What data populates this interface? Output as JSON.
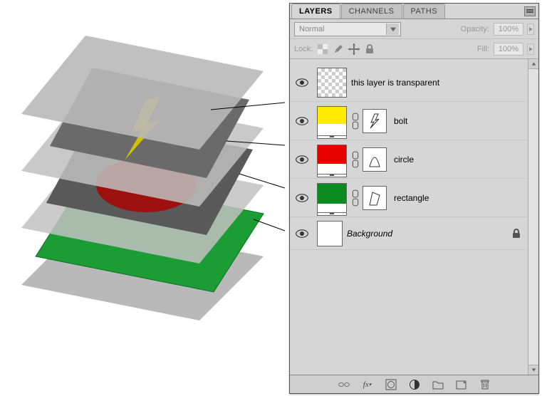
{
  "tabs": {
    "layers": "LAYERS",
    "channels": "CHANNELS",
    "paths": "PATHS"
  },
  "controls": {
    "blend_mode": "Normal",
    "opacity_label": "Opacity:",
    "opacity_value": "100%",
    "lock_label": "Lock:",
    "fill_label": "Fill:",
    "fill_value": "100%"
  },
  "layers": [
    {
      "name": "this layer is transparent",
      "thumb": "trans",
      "has_mask": false,
      "has_smart": false
    },
    {
      "name": "bolt",
      "thumb": "yellow",
      "has_mask": true,
      "has_smart": true
    },
    {
      "name": "circle",
      "thumb": "red",
      "has_mask": true,
      "has_smart": true
    },
    {
      "name": "rectangle",
      "thumb": "green",
      "has_mask": true,
      "has_smart": true
    },
    {
      "name": "Background",
      "thumb": "white",
      "has_mask": false,
      "has_smart": false,
      "italic": true,
      "locked": true
    }
  ],
  "lock-icons": [
    "checker-icon",
    "brush-icon",
    "move-icon",
    "lock-icon"
  ],
  "footer_icons": [
    "link-icon",
    "fx-icon",
    "mask-icon",
    "adjust-icon",
    "group-icon",
    "new-layer-icon",
    "trash-icon"
  ]
}
